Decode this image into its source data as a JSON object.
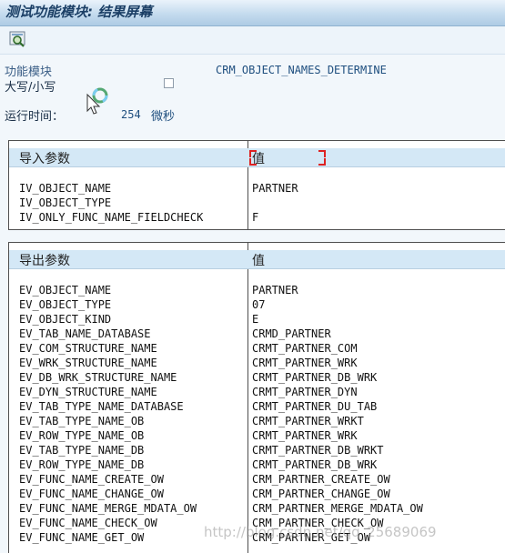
{
  "window": {
    "title": "测试功能模块: 结果屏幕"
  },
  "toolbar": {
    "icon": "magnifier-icon"
  },
  "info": {
    "module_label": "功能模块",
    "module_value": "CRM_OBJECT_NAMES_DETERMINE",
    "case_label": "大写/小写",
    "case_checked": false,
    "runtime_label": "运行时间：",
    "runtime_value": "254",
    "runtime_unit": "微秒"
  },
  "import_table": {
    "col_param": "导入参数",
    "col_value": "值",
    "rows": [
      {
        "name": "IV_OBJECT_NAME",
        "value": "PARTNER"
      },
      {
        "name": "IV_OBJECT_TYPE",
        "value": ""
      },
      {
        "name": "IV_ONLY_FUNC_NAME_FIELDCHECK",
        "value": "F"
      }
    ]
  },
  "export_table": {
    "col_param": "导出参数",
    "col_value": "值",
    "rows": [
      {
        "name": "EV_OBJECT_NAME",
        "value": "PARTNER"
      },
      {
        "name": "EV_OBJECT_TYPE",
        "value": "07"
      },
      {
        "name": "EV_OBJECT_KIND",
        "value": "E"
      },
      {
        "name": "EV_TAB_NAME_DATABASE",
        "value": "CRMD_PARTNER"
      },
      {
        "name": "EV_COM_STRUCTURE_NAME",
        "value": "CRMT_PARTNER_COM"
      },
      {
        "name": "EV_WRK_STRUCTURE_NAME",
        "value": "CRMT_PARTNER_WRK"
      },
      {
        "name": "EV_DB_WRK_STRUCTURE_NAME",
        "value": "CRMT_PARTNER_DB_WRK"
      },
      {
        "name": "EV_DYN_STRUCTURE_NAME",
        "value": "CRMT_PARTNER_DYN"
      },
      {
        "name": "EV_TAB_TYPE_NAME_DATABASE",
        "value": "CRMT_PARTNER_DU_TAB"
      },
      {
        "name": "EV_TAB_TYPE_NAME_OB",
        "value": "CRMT_PARTNER_WRKT"
      },
      {
        "name": "EV_ROW_TYPE_NAME_OB",
        "value": "CRMT_PARTNER_WRK"
      },
      {
        "name": "EV_TAB_TYPE_NAME_DB",
        "value": "CRMT_PARTNER_DB_WRKT"
      },
      {
        "name": "EV_ROW_TYPE_NAME_DB",
        "value": "CRMT_PARTNER_DB_WRK"
      },
      {
        "name": "EV_FUNC_NAME_CREATE_OW",
        "value": "CRM_PARTNER_CREATE_OW"
      },
      {
        "name": "EV_FUNC_NAME_CHANGE_OW",
        "value": "CRM_PARTNER_CHANGE_OW"
      },
      {
        "name": "EV_FUNC_NAME_MERGE_MDATA_OW",
        "value": "CRM_PARTNER_MERGE_MDATA_OW"
      },
      {
        "name": "EV_FUNC_NAME_CHECK_OW",
        "value": "CRM_PARTNER_CHECK_OW"
      },
      {
        "name": "EV_FUNC_NAME_GET_OW",
        "value": "CRM_PARTNER_GET_OW"
      }
    ]
  },
  "watermark": "http://blog.csdn.net/qq_25689069"
}
